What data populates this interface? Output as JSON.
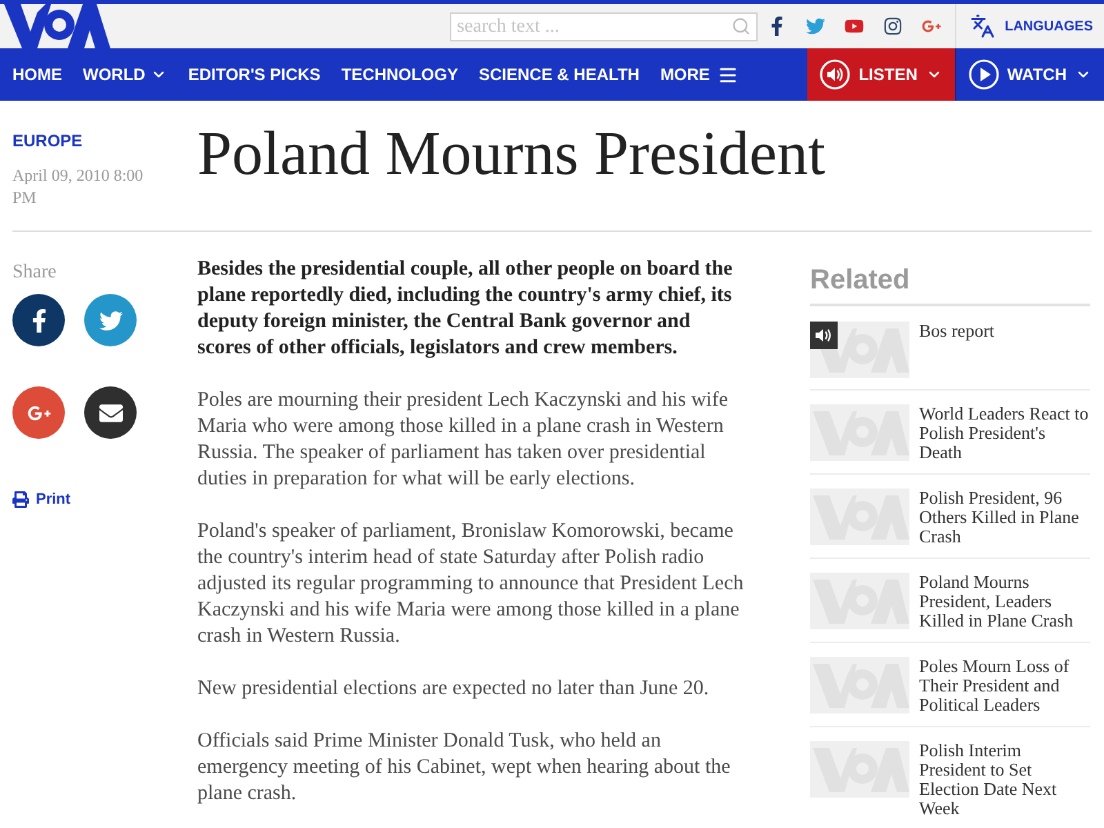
{
  "header": {
    "search": {
      "placeholder": "search text ..."
    },
    "languages": {
      "label": "LANGUAGES"
    }
  },
  "nav": {
    "items": [
      {
        "label": "HOME",
        "kind": "link"
      },
      {
        "label": "WORLD",
        "kind": "dropdown"
      },
      {
        "label": "EDITOR'S PICKS",
        "kind": "link"
      },
      {
        "label": "TECHNOLOGY",
        "kind": "link"
      },
      {
        "label": "SCIENCE & HEALTH",
        "kind": "link"
      },
      {
        "label": "MORE",
        "kind": "menu"
      }
    ],
    "media": [
      {
        "label": "LISTEN",
        "kind": "listen"
      },
      {
        "label": "WATCH",
        "kind": "watch"
      }
    ]
  },
  "article": {
    "section": "EUROPE",
    "date": "April 09, 2010 8:00 PM",
    "title": "Poland Mourns President",
    "share_label": "Share",
    "print_label": "Print",
    "paragraphs": [
      {
        "kind": "lead",
        "text": "Besides the presidential couple, all other people on board the plane reportedly died, including the country's army chief, its deputy foreign minister, the Central Bank governor and scores of other officials, legislators and crew members."
      },
      {
        "kind": "body",
        "text": "Poles are mourning their president Lech Kaczynski and his wife Maria who were among those killed in a plane crash in Western Russia. The speaker of parliament has taken over presidential duties in preparation for what will be early elections."
      },
      {
        "kind": "body",
        "text": "Poland's speaker of parliament, Bronislaw Komorowski, became the country's interim head of state Saturday after Polish radio adjusted its regular programming to announce that President Lech Kaczynski and his wife Maria were among those killed in a plane crash in Western Russia."
      },
      {
        "kind": "body",
        "text": "New presidential elections are expected no later than June 20."
      },
      {
        "kind": "body",
        "text": "Officials said Prime Minister Donald Tusk, who held an emergency meeting of his Cabinet, wept when hearing about the plane crash."
      }
    ]
  },
  "related": {
    "heading": "Related",
    "items": [
      {
        "title": "Bos report",
        "kind": "audio"
      },
      {
        "title": "World Leaders React to Polish President's Death",
        "kind": "article"
      },
      {
        "title": "Polish President, 96 Others Killed in Plane Crash",
        "kind": "article"
      },
      {
        "title": "Poland Mourns President, Leaders Killed in Plane Crash",
        "kind": "article"
      },
      {
        "title": "Poles Mourn Loss of Their President and Political Leaders",
        "kind": "article"
      },
      {
        "title": "Polish Interim President to Set Election Date Next Week",
        "kind": "article"
      }
    ]
  }
}
